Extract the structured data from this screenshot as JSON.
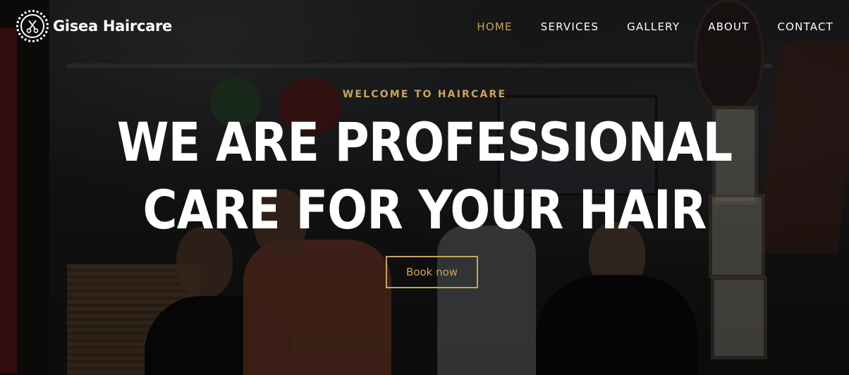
{
  "brand": {
    "name": "Gisea Haircare",
    "logo_icon": "scissors-icon"
  },
  "nav": {
    "items": [
      {
        "label": "HOME",
        "active": true
      },
      {
        "label": "SERVICES",
        "active": false
      },
      {
        "label": "GALLERY",
        "active": false
      },
      {
        "label": "ABOUT",
        "active": false
      },
      {
        "label": "CONTACT",
        "active": false
      }
    ]
  },
  "hero": {
    "eyebrow": "WELCOME TO HAIRCARE",
    "headline": "WE ARE PROFESSIONAL CARE FOR YOUR HAIR",
    "cta_label": "Book now"
  },
  "colors": {
    "accent": "#c9a35c",
    "text": "#ffffff",
    "overlay": "#000000"
  }
}
